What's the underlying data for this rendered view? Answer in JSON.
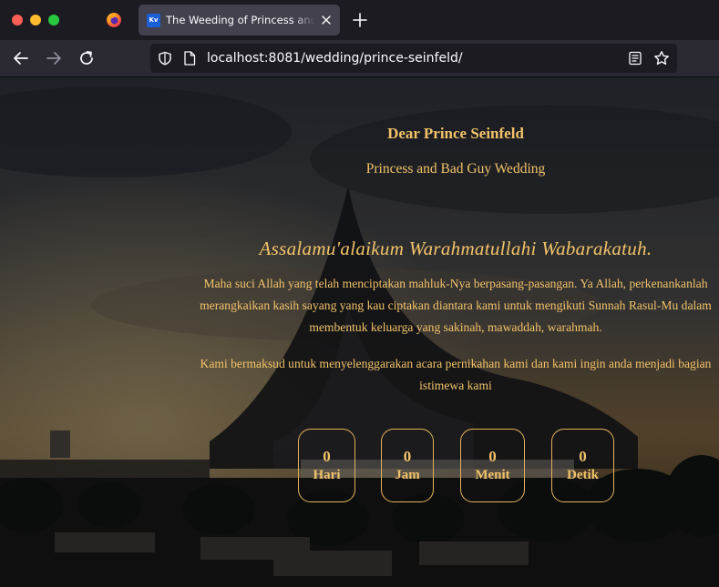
{
  "browser": {
    "tab_title": "The Weeding of Princess and Bad Guy Wedding",
    "tab_favicon_text": "Kv",
    "url": "localhost:8081/wedding/prince-seinfeld/",
    "icons": [
      "firefox-icon",
      "close-icon",
      "plus-icon",
      "back-arrow-icon",
      "forward-arrow-icon",
      "reload-icon",
      "shield-icon",
      "page-icon",
      "reader-view-icon",
      "bookmark-star-icon"
    ]
  },
  "invitation": {
    "greeting": "Dear Prince Seinfeld",
    "subtitle": "Princess and Bad Guy Wedding",
    "salam": "Assalamu'alaikum Warahmatullahi Wabarakatuh.",
    "paragraph1": [
      "Maha suci Allah yang telah menciptakan mahluk-Nya berpasang-pasangan. Ya Allah, perkenankanlah",
      "merangkaikan kasih sayang yang kau ciptakan diantara kami untuk mengikuti Sunnah Rasul-Mu dalam",
      "membentuk keluarga yang sakinah, mawaddah, warahmah."
    ],
    "paragraph2": [
      "Kami bermaksud untuk menyelenggarakan acara pernikahan kami dan kami ingin anda menjadi bagian",
      "istimewa kami"
    ]
  },
  "countdown": [
    {
      "value": "0",
      "label": "Hari"
    },
    {
      "value": "0",
      "label": "Jam"
    },
    {
      "value": "0",
      "label": "Menit"
    },
    {
      "value": "0",
      "label": "Detik"
    }
  ],
  "colors": {
    "accent_gold": "#f2c36a",
    "browser_bg": "#1c1b22",
    "toolbar_bg": "#2b2a33"
  }
}
